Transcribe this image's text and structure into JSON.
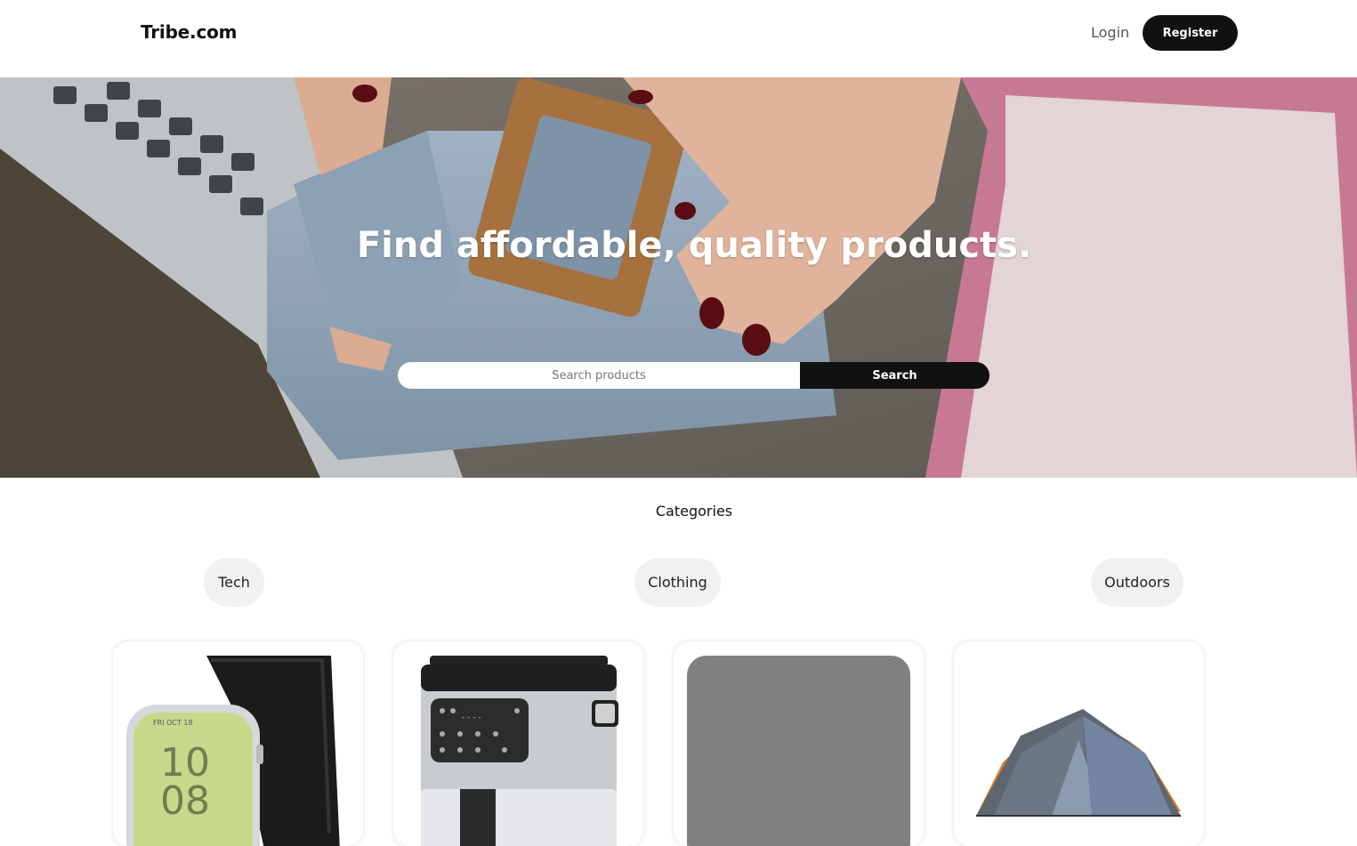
{
  "header": {
    "brand": "Tribe.com",
    "login_label": "Login",
    "register_label": "Register"
  },
  "hero": {
    "title": "Find affordable, quality products.",
    "search_placeholder": "Search products",
    "search_button": "Search"
  },
  "categories": {
    "heading": "Categories",
    "items": [
      "Tech",
      "Clothing",
      "Outdoors"
    ]
  },
  "products": [
    {
      "image": "smartwatch-image"
    },
    {
      "image": "air-fryer-image"
    },
    {
      "image": "placeholder-image"
    },
    {
      "image": "tent-image"
    }
  ],
  "colors": {
    "primary": "#111111",
    "pill_bg": "#f1f1f1",
    "placeholder_gray": "#808080"
  }
}
